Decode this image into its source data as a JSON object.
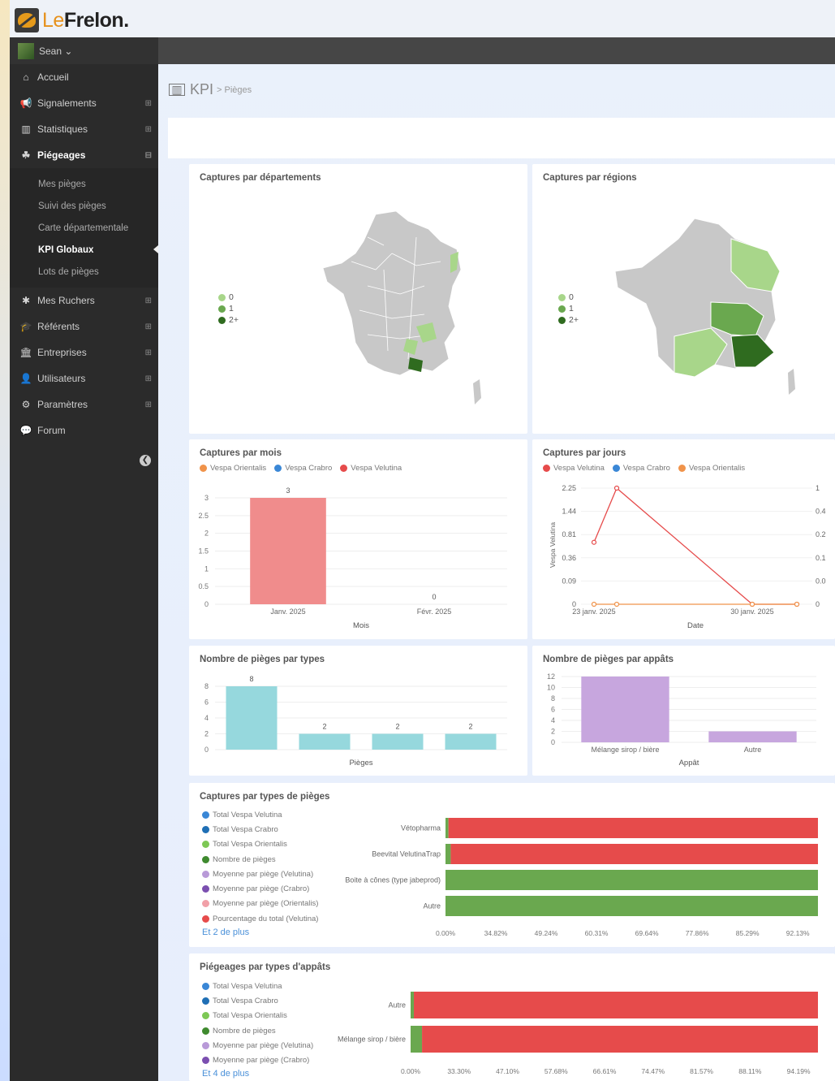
{
  "app": {
    "logo_le": "Le",
    "logo_rest": "Frelon."
  },
  "user": {
    "name": "Sean ⌄"
  },
  "sidebar": {
    "items": [
      {
        "label": "Accueil",
        "icon": "home-icon"
      },
      {
        "label": "Signalements",
        "icon": "megaphone-icon"
      },
      {
        "label": "Statistiques",
        "icon": "bar-chart-icon"
      },
      {
        "label": "Piégeages",
        "icon": "group-icon"
      }
    ],
    "sub_items": [
      "Mes pièges",
      "Suivi des pièges",
      "Carte départementale",
      "KPI Globaux",
      "Lots de pièges"
    ],
    "items_bottom": [
      {
        "label": "Mes Ruchers",
        "icon": "hive-icon"
      },
      {
        "label": "Référents",
        "icon": "graduation-cap-icon"
      },
      {
        "label": "Entreprises",
        "icon": "building-icon"
      },
      {
        "label": "Utilisateurs",
        "icon": "user-icon"
      },
      {
        "label": "Paramètres",
        "icon": "gears-icon"
      },
      {
        "label": "Forum",
        "icon": "comments-icon"
      }
    ],
    "plus_symbol": "⊞",
    "minus_symbol": "⊟",
    "collapse_symbol": "❮"
  },
  "breadcrumb": {
    "icon": "bar-chart-icon",
    "title": "KPI",
    "sub": "> Pièges"
  },
  "map_legend": [
    "0",
    "1",
    "2+"
  ],
  "cards": {
    "departements": {
      "title": "Captures par départements"
    },
    "regions": {
      "title": "Captures par régions"
    },
    "mois": {
      "title": "Captures par mois",
      "legend": [
        "Vespa Orientalis",
        "Vespa Crabro",
        "Vespa Velutina"
      ]
    },
    "jours": {
      "title": "Captures par jours",
      "legend": [
        "Vespa Velutina",
        "Vespa Crabro",
        "Vespa Orientalis"
      ]
    },
    "types": {
      "title": "Nombre de pièges par types"
    },
    "appats": {
      "title": "Nombre de pièges par appâts"
    },
    "captures_types": {
      "title": "Captures par types de pièges",
      "legend": [
        "Total Vespa Velutina",
        "Total Vespa Crabro",
        "Total Vespa Orientalis",
        "Nombre de pièges",
        "Moyenne par piège (Velutina)",
        "Moyenne par piège (Crabro)",
        "Moyenne par piège (Orientalis)",
        "Pourcentage du total (Velutina)"
      ],
      "more": "Et 2 de plus"
    },
    "piegeages_appats": {
      "title": "Piégeages par types d'appâts",
      "legend": [
        "Total Vespa Velutina",
        "Total Vespa Crabro",
        "Total Vespa Orientalis",
        "Nombre de pièges",
        "Moyenne par piège (Velutina)",
        "Moyenne par piège (Crabro)"
      ],
      "more": "Et 4 de plus"
    }
  },
  "colors": {
    "velutina": "#e64b4b",
    "crabro": "#3a87d6",
    "orientalis": "#f0934a",
    "bar_mois": "#f08c8c",
    "bar_types": "#96d8dd",
    "bar_appats": "#c7a6de",
    "green": "#6aa84f",
    "map_grey": "#c8c8c8"
  },
  "chart_data": [
    {
      "type": "bar",
      "title": "Captures par mois",
      "categories": [
        "Janv. 2025",
        "Févr. 2025"
      ],
      "series": [
        {
          "name": "Vespa Velutina",
          "values": [
            3,
            0
          ]
        }
      ],
      "xlabel": "Mois",
      "yticks": [
        "0",
        "0.5",
        "1",
        "1.5",
        "2",
        "2.5",
        "3"
      ],
      "ylim": [
        0,
        3
      ]
    },
    {
      "type": "line",
      "title": "Captures par jours",
      "x": [
        "23 janv. 2025",
        "24 janv. 2025",
        "30 janv. 2025",
        "31 janv. 2025"
      ],
      "xticks": [
        "23 janv. 2025",
        "30 janv. 2025"
      ],
      "series": [
        {
          "name": "Vespa Velutina",
          "values": [
            0.64,
            2.25,
            0,
            0
          ]
        },
        {
          "name": "Vespa Orientalis",
          "values": [
            0,
            0,
            0,
            0
          ]
        }
      ],
      "xlabel": "Date",
      "ylabel": "Vespa Velutina",
      "yticks_left": [
        "0",
        "0.09",
        "0.36",
        "0.81",
        "1.44",
        "2.25"
      ],
      "yticks_right": [
        "0",
        "0.0",
        "0.1",
        "0.2",
        "0.4",
        "1"
      ]
    },
    {
      "type": "bar",
      "title": "Nombre de pièges par types",
      "categories": [
        "",
        "",
        "",
        ""
      ],
      "values": [
        8,
        2,
        2,
        2
      ],
      "xlabel": "Pièges",
      "yticks": [
        "0",
        "2",
        "4",
        "6",
        "8"
      ],
      "ylim": [
        0,
        8
      ]
    },
    {
      "type": "bar",
      "title": "Nombre de pièges par appâts",
      "categories": [
        "Mélange sirop / bière",
        "Autre"
      ],
      "values": [
        12,
        2
      ],
      "xlabel": "Appât",
      "yticks": [
        "0",
        "2",
        "4",
        "6",
        "8",
        "10",
        "12"
      ],
      "ylim": [
        0,
        12
      ]
    },
    {
      "type": "bar",
      "title": "Captures par types de pièges",
      "orientation": "horizontal-stacked",
      "categories": [
        "Vétopharma",
        "Beevital VelutinaTrap",
        "Boite à cônes (type jabeprod)",
        "Autre"
      ],
      "series": [
        {
          "name": "Nombre de pièges",
          "values": [
            0.8,
            1.4,
            100,
            100
          ]
        },
        {
          "name": "Pourcentage du total (Velutina)",
          "values": [
            99.2,
            98.6,
            0,
            0
          ]
        }
      ],
      "xticks": [
        "0.00%",
        "34.82%",
        "49.24%",
        "60.31%",
        "69.64%",
        "77.86%",
        "85.29%",
        "92.13%"
      ]
    },
    {
      "type": "bar",
      "title": "Piégeages par types d'appâts",
      "orientation": "horizontal-stacked",
      "categories": [
        "Autre",
        "Mélange sirop / bière"
      ],
      "series": [
        {
          "name": "Nombre de pièges",
          "values": [
            0.8,
            2.8
          ]
        },
        {
          "name": "Pourcentage du total (Velutina)",
          "values": [
            99.2,
            97.2
          ]
        }
      ],
      "xticks": [
        "0.00%",
        "33.30%",
        "47.10%",
        "57.68%",
        "66.61%",
        "74.47%",
        "81.57%",
        "88.11%",
        "94.19%"
      ]
    }
  ]
}
